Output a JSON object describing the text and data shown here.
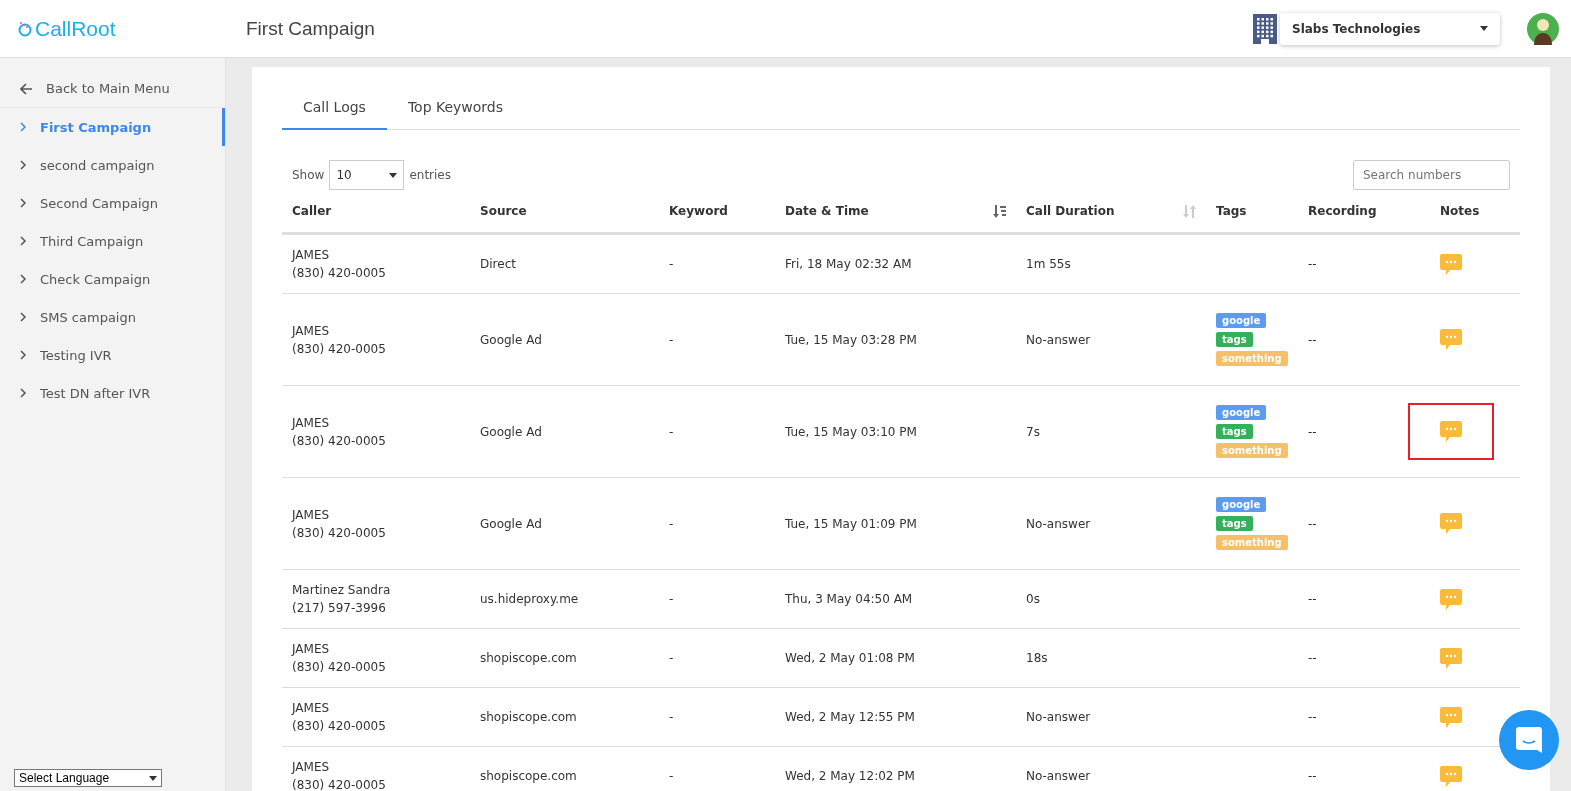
{
  "header": {
    "logo": "CallRoot",
    "title": "First Campaign",
    "company": "Slabs Technologies"
  },
  "sidebar": {
    "back": "Back to Main Menu",
    "items": [
      {
        "label": "First Campaign",
        "selected": true
      },
      {
        "label": "second campaign",
        "selected": false
      },
      {
        "label": "Second Campaign",
        "selected": false
      },
      {
        "label": "Third Campaign",
        "selected": false
      },
      {
        "label": "Check Campaign",
        "selected": false
      },
      {
        "label": "SMS campaign",
        "selected": false
      },
      {
        "label": "Testing IVR",
        "selected": false
      },
      {
        "label": "Test DN after IVR",
        "selected": false
      }
    ],
    "language": "Select Language"
  },
  "tabs": [
    {
      "label": "Call Logs",
      "selected": true
    },
    {
      "label": "Top Keywords",
      "selected": false
    }
  ],
  "controls": {
    "show": "Show",
    "entries_value": "10",
    "entries": "entries",
    "search_placeholder": "Search numbers"
  },
  "table": {
    "columns": [
      {
        "label": "Caller"
      },
      {
        "label": "Source"
      },
      {
        "label": "Keyword"
      },
      {
        "label": "Date & Time",
        "sortable": true,
        "sorted": true
      },
      {
        "label": "Call Duration",
        "sortable": true,
        "sorted": false
      },
      {
        "label": "Tags"
      },
      {
        "label": "Recording"
      },
      {
        "label": "Notes"
      }
    ],
    "rows": [
      {
        "name": "JAMES",
        "phone": "(830) 420-0005",
        "source": "Direct",
        "keyword": "-",
        "date": "Fri, 18 May 02:32 AM",
        "duration": "1m 55s",
        "tags": [],
        "recording": "--",
        "note_highlighted": false
      },
      {
        "name": "JAMES",
        "phone": "(830) 420-0005",
        "source": "Google Ad",
        "keyword": "-",
        "date": "Tue, 15 May 03:28 PM",
        "duration": "No-answer",
        "tags": [
          {
            "label": "google",
            "color": "#5b9cf0"
          },
          {
            "label": "tags",
            "color": "#34b05a"
          },
          {
            "label": "something",
            "color": "#f5c06a"
          }
        ],
        "recording": "--",
        "note_highlighted": false
      },
      {
        "name": "JAMES",
        "phone": "(830) 420-0005",
        "source": "Google Ad",
        "keyword": "-",
        "date": "Tue, 15 May 03:10 PM",
        "duration": "7s",
        "tags": [
          {
            "label": "google",
            "color": "#5b9cf0"
          },
          {
            "label": "tags",
            "color": "#34b05a"
          },
          {
            "label": "something",
            "color": "#f5c06a"
          }
        ],
        "recording": "--",
        "note_highlighted": true
      },
      {
        "name": "JAMES",
        "phone": "(830) 420-0005",
        "source": "Google Ad",
        "keyword": "-",
        "date": "Tue, 15 May 01:09 PM",
        "duration": "No-answer",
        "tags": [
          {
            "label": "google",
            "color": "#5b9cf0"
          },
          {
            "label": "tags",
            "color": "#34b05a"
          },
          {
            "label": "something",
            "color": "#f5c06a"
          }
        ],
        "recording": "--",
        "note_highlighted": false
      },
      {
        "name": "Martinez Sandra",
        "phone": "(217) 597-3996",
        "source": "us.hideproxy.me",
        "keyword": "-",
        "date": "Thu, 3 May 04:50 AM",
        "duration": "0s",
        "tags": [],
        "recording": "--",
        "note_highlighted": false
      },
      {
        "name": "JAMES",
        "phone": "(830) 420-0005",
        "source": "shopiscope.com",
        "keyword": "-",
        "date": "Wed, 2 May 01:08 PM",
        "duration": "18s",
        "tags": [],
        "recording": "--",
        "note_highlighted": false
      },
      {
        "name": "JAMES",
        "phone": "(830) 420-0005",
        "source": "shopiscope.com",
        "keyword": "-",
        "date": "Wed, 2 May 12:55 PM",
        "duration": "No-answer",
        "tags": [],
        "recording": "--",
        "note_highlighted": false
      },
      {
        "name": "JAMES",
        "phone": "(830) 420-0005",
        "source": "shopiscope.com",
        "keyword": "-",
        "date": "Wed, 2 May 12:02 PM",
        "duration": "No-answer",
        "tags": [],
        "recording": "--",
        "note_highlighted": false
      }
    ]
  }
}
